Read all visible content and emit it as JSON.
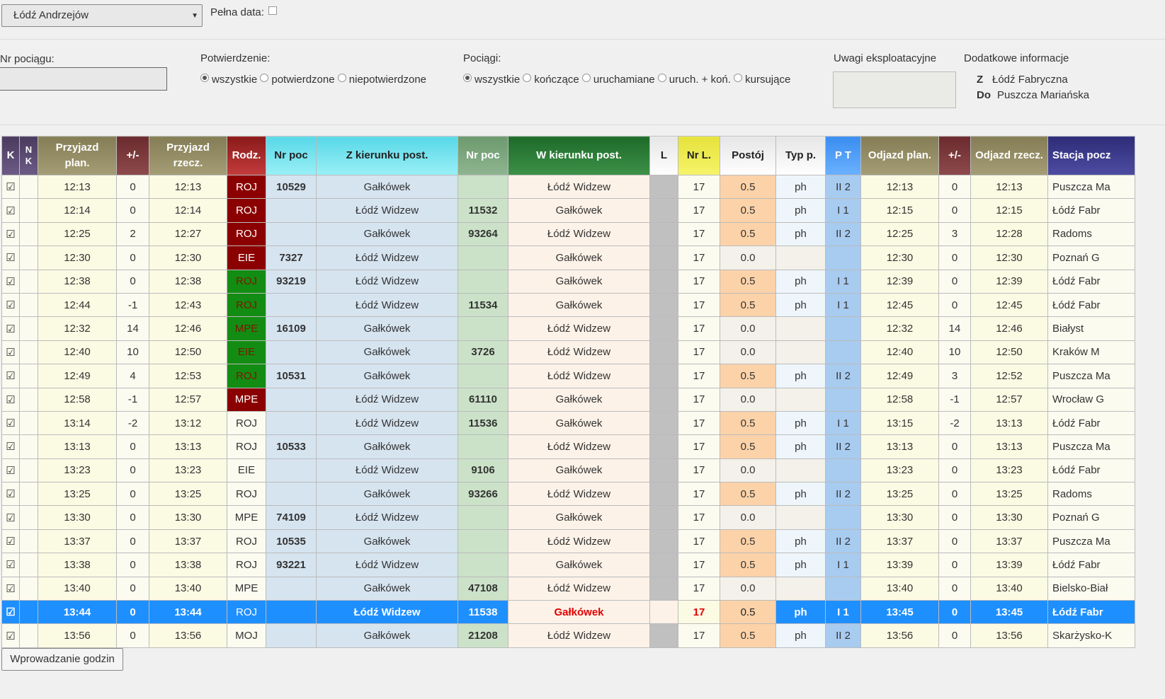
{
  "station": {
    "selected": "Łódź Andrzejów"
  },
  "pelna_data_label": "Pełna data:",
  "filters": {
    "nr_pociagu_label": "Nr pociągu:",
    "potwierdzenie_label": "Potwierdzenie:",
    "potwierdzenie_options": [
      "wszystkie",
      "potwierdzone",
      "niepotwierdzone"
    ],
    "pociagi_label": "Pociągi:",
    "pociagi_options": [
      "wszystkie",
      "kończące",
      "uruchamiane",
      "uruch. + koń.",
      "kursujące"
    ],
    "uwagi_label": "Uwagi eksploatacyjne",
    "dodatkowe_label": "Dodatkowe informacje",
    "z_label": "Z",
    "z_value": "Łódź Fabryczna",
    "do_label": "Do",
    "do_value": "Puszcza Mariańska"
  },
  "table": {
    "headers": {
      "k": "K",
      "nk": "N K",
      "przyjazd_plan": "Przyjazd plan.",
      "pm1": "+/-",
      "przyjazd_rzecz": "Przyjazd rzecz.",
      "rodz": "Rodz.",
      "nrpoc1": "Nr poc",
      "z_kierunku": "Z kierunku post.",
      "nrpoc2": "Nr poc",
      "w_kierunku": "W kierunku post.",
      "l": "L",
      "nrl": "Nr L.",
      "postoj": "Postój",
      "typ": "Typ p.",
      "pt": "P T",
      "odjazd_plan": "Odjazd plan.",
      "pm2": "+/-",
      "odjazd_rzecz": "Odjazd rzecz.",
      "stacja": "Stacja pocz"
    },
    "rows": [
      {
        "k": "☑",
        "pp": "12:13",
        "d1": "0",
        "pr": "12:13",
        "rodz": "ROJ",
        "n1": "10529",
        "z": "Gałkówek",
        "n2": "",
        "w": "Łódź Widzew",
        "nrl": "17",
        "post": "0.5",
        "typ": "ph",
        "pt": "II 2",
        "op": "12:13",
        "d2": "0",
        "or": "12:13",
        "st": "Puszcza Ma"
      },
      {
        "k": "☑",
        "pp": "12:14",
        "d1": "0",
        "pr": "12:14",
        "rodz": "ROJ",
        "n1": "",
        "z": "Łódź Widzew",
        "n2": "11532",
        "w": "Gałkówek",
        "nrl": "17",
        "post": "0.5",
        "typ": "ph",
        "pt": "I 1",
        "op": "12:15",
        "d2": "0",
        "or": "12:15",
        "st": "Łódź Fabr"
      },
      {
        "k": "☑",
        "pp": "12:25",
        "d1": "2",
        "pr": "12:27",
        "rodz": "ROJ",
        "n1": "",
        "z": "Gałkówek",
        "n2": "93264",
        "w": "Łódź Widzew",
        "nrl": "17",
        "post": "0.5",
        "typ": "ph",
        "pt": "II 2",
        "op": "12:25",
        "d2": "3",
        "or": "12:28",
        "st": "Radoms"
      },
      {
        "k": "☑",
        "pp": "12:30",
        "d1": "0",
        "pr": "12:30",
        "rodz": "EIE",
        "n1": "7327",
        "z": "Łódź Widzew",
        "n2": "",
        "w": "Gałkówek",
        "nrl": "17",
        "post": "0.0",
        "typ": "",
        "pt": "",
        "op": "12:30",
        "d2": "0",
        "or": "12:30",
        "st": "Poznań G"
      },
      {
        "k": "☑",
        "pp": "12:38",
        "d1": "0",
        "pr": "12:38",
        "rodz": "ROJ",
        "n1": "93219",
        "z": "Łódź Widzew",
        "n2": "",
        "w": "Gałkówek",
        "nrl": "17",
        "post": "0.5",
        "typ": "ph",
        "pt": "I 1",
        "op": "12:39",
        "d2": "0",
        "or": "12:39",
        "st": "Łódź Fabr"
      },
      {
        "k": "☑",
        "pp": "12:44",
        "d1": "-1",
        "pr": "12:43",
        "rodz": "ROJ",
        "n1": "",
        "z": "Łódź Widzew",
        "n2": "11534",
        "w": "Gałkówek",
        "nrl": "17",
        "post": "0.5",
        "typ": "ph",
        "pt": "I 1",
        "op": "12:45",
        "d2": "0",
        "or": "12:45",
        "st": "Łódź Fabr"
      },
      {
        "k": "☑",
        "pp": "12:32",
        "d1": "14",
        "pr": "12:46",
        "rodz": "MPE",
        "n1": "16109",
        "z": "Gałkówek",
        "n2": "",
        "w": "Łódź Widzew",
        "nrl": "17",
        "post": "0.0",
        "typ": "",
        "pt": "",
        "op": "12:32",
        "d2": "14",
        "or": "12:46",
        "st": "Białyst"
      },
      {
        "k": "☑",
        "pp": "12:40",
        "d1": "10",
        "pr": "12:50",
        "rodz": "EIE",
        "n1": "",
        "z": "Gałkówek",
        "n2": "3726",
        "w": "Łódź Widzew",
        "nrl": "17",
        "post": "0.0",
        "typ": "",
        "pt": "",
        "op": "12:40",
        "d2": "10",
        "or": "12:50",
        "st": "Kraków M"
      },
      {
        "k": "☑",
        "pp": "12:49",
        "d1": "4",
        "pr": "12:53",
        "rodz": "ROJ",
        "n1": "10531",
        "z": "Gałkówek",
        "n2": "",
        "w": "Łódź Widzew",
        "nrl": "17",
        "post": "0.5",
        "typ": "ph",
        "pt": "II 2",
        "op": "12:49",
        "d2": "3",
        "or": "12:52",
        "st": "Puszcza Ma"
      },
      {
        "k": "☑",
        "pp": "12:58",
        "d1": "-1",
        "pr": "12:57",
        "rodz": "MPE",
        "n1": "",
        "z": "Łódź Widzew",
        "n2": "61110",
        "w": "Gałkówek",
        "nrl": "17",
        "post": "0.0",
        "typ": "",
        "pt": "",
        "op": "12:58",
        "d2": "-1",
        "or": "12:57",
        "st": "Wrocław G"
      },
      {
        "k": "☑",
        "pp": "13:14",
        "d1": "-2",
        "pr": "13:12",
        "rodz": "ROJ",
        "n1": "",
        "z": "Łódź Widzew",
        "n2": "11536",
        "w": "Gałkówek",
        "nrl": "17",
        "post": "0.5",
        "typ": "ph",
        "pt": "I 1",
        "op": "13:15",
        "d2": "-2",
        "or": "13:13",
        "st": "Łódź Fabr"
      },
      {
        "k": "☑",
        "pp": "13:13",
        "d1": "0",
        "pr": "13:13",
        "rodz": "ROJ",
        "n1": "10533",
        "z": "Gałkówek",
        "n2": "",
        "w": "Łódź Widzew",
        "nrl": "17",
        "post": "0.5",
        "typ": "ph",
        "pt": "II 2",
        "op": "13:13",
        "d2": "0",
        "or": "13:13",
        "st": "Puszcza Ma"
      },
      {
        "k": "☑",
        "pp": "13:23",
        "d1": "0",
        "pr": "13:23",
        "rodz": "EIE",
        "n1": "",
        "z": "Łódź Widzew",
        "n2": "9106",
        "w": "Gałkówek",
        "nrl": "17",
        "post": "0.0",
        "typ": "",
        "pt": "",
        "op": "13:23",
        "d2": "0",
        "or": "13:23",
        "st": "Łódź Fabr"
      },
      {
        "k": "☑",
        "pp": "13:25",
        "d1": "0",
        "pr": "13:25",
        "rodz": "ROJ",
        "n1": "",
        "z": "Gałkówek",
        "n2": "93266",
        "w": "Łódź Widzew",
        "nrl": "17",
        "post": "0.5",
        "typ": "ph",
        "pt": "II 2",
        "op": "13:25",
        "d2": "0",
        "or": "13:25",
        "st": "Radoms"
      },
      {
        "k": "☑",
        "pp": "13:30",
        "d1": "0",
        "pr": "13:30",
        "rodz": "MPE",
        "n1": "74109",
        "z": "Łódź Widzew",
        "n2": "",
        "w": "Gałkówek",
        "nrl": "17",
        "post": "0.0",
        "typ": "",
        "pt": "",
        "op": "13:30",
        "d2": "0",
        "or": "13:30",
        "st": "Poznań G"
      },
      {
        "k": "☑",
        "pp": "13:37",
        "d1": "0",
        "pr": "13:37",
        "rodz": "ROJ",
        "n1": "10535",
        "z": "Gałkówek",
        "n2": "",
        "w": "Łódź Widzew",
        "nrl": "17",
        "post": "0.5",
        "typ": "ph",
        "pt": "II 2",
        "op": "13:37",
        "d2": "0",
        "or": "13:37",
        "st": "Puszcza Ma"
      },
      {
        "k": "☑",
        "pp": "13:38",
        "d1": "0",
        "pr": "13:38",
        "rodz": "ROJ",
        "n1": "93221",
        "z": "Łódź Widzew",
        "n2": "",
        "w": "Gałkówek",
        "nrl": "17",
        "post": "0.5",
        "typ": "ph",
        "pt": "I 1",
        "op": "13:39",
        "d2": "0",
        "or": "13:39",
        "st": "Łódź Fabr"
      },
      {
        "k": "☑",
        "pp": "13:40",
        "d1": "0",
        "pr": "13:40",
        "rodz": "MPE",
        "n1": "",
        "z": "Gałkówek",
        "n2": "47108",
        "w": "Łódź Widzew",
        "nrl": "17",
        "post": "0.0",
        "typ": "",
        "pt": "",
        "op": "13:40",
        "d2": "0",
        "or": "13:40",
        "st": "Bielsko-Biał"
      },
      {
        "k": "☑",
        "pp": "13:44",
        "d1": "0",
        "pr": "13:44",
        "rodz": "ROJ",
        "n1": "",
        "z": "Łódź Widzew",
        "n2": "11538",
        "w": "Gałkówek",
        "nrl": "17",
        "post": "0.5",
        "typ": "ph",
        "pt": "I 1",
        "op": "13:45",
        "d2": "0",
        "or": "13:45",
        "st": "Łódź Fabr"
      },
      {
        "k": "☑",
        "pp": "13:56",
        "d1": "0",
        "pr": "13:56",
        "rodz": "MOJ",
        "n1": "",
        "z": "Gałkówek",
        "n2": "21208",
        "w": "Łódź Widzew",
        "nrl": "17",
        "post": "0.5",
        "typ": "ph",
        "pt": "II 2",
        "op": "13:56",
        "d2": "0",
        "or": "13:56",
        "st": "Skarżysko-K"
      }
    ]
  },
  "rodz_styles": [
    "red",
    "red",
    "red",
    "red",
    "green",
    "green",
    "green",
    "green",
    "green",
    "red",
    "",
    "",
    "",
    "",
    "",
    "",
    "",
    "",
    "",
    ""
  ],
  "selected_row": 18,
  "wprowadzanie_label": "Wprowadzanie godzin"
}
